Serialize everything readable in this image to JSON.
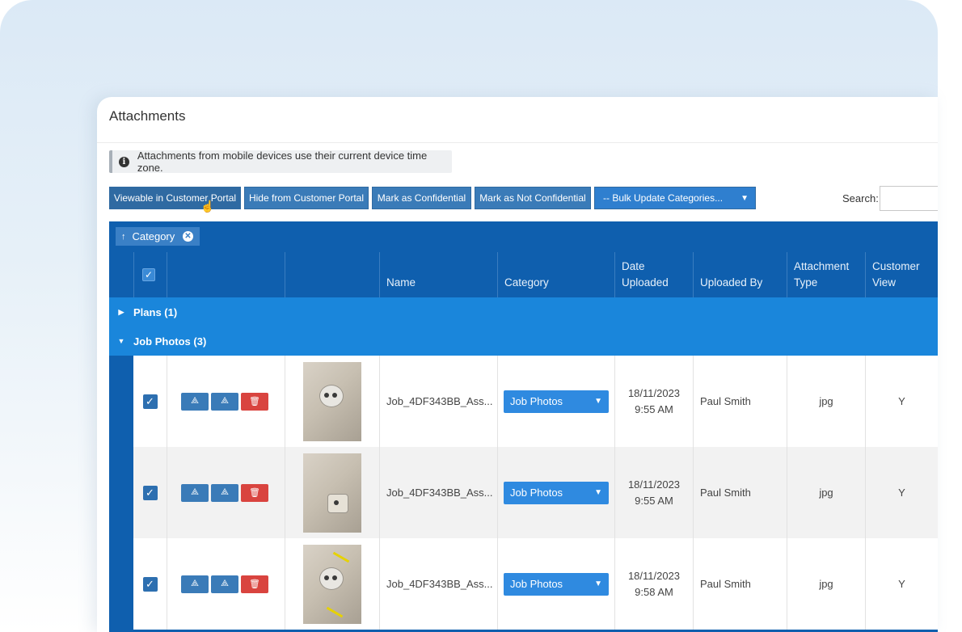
{
  "panel": {
    "title": "Attachments"
  },
  "notice": {
    "icon": "info-icon",
    "text": "Attachments from mobile devices use their current device time zone."
  },
  "toolbar": {
    "buttons": [
      "Viewable in Customer Portal",
      "Hide from Customer Portal",
      "Mark as Confidential",
      "Mark as Not Confidential"
    ],
    "bulk_dropdown": "-- Bulk Update Categories..."
  },
  "search": {
    "label": "Search:",
    "value": ""
  },
  "grouping": {
    "chip_label": "Category",
    "chip_arrow": "↑"
  },
  "columns": {
    "name": "Name",
    "category": "Category",
    "date_uploaded": "Date Uploaded",
    "uploaded_by": "Uploaded By",
    "attachment_type": "Attachment Type",
    "customer_view": "Customer View"
  },
  "groups": [
    {
      "label": "Plans (1)",
      "expanded": false
    },
    {
      "label": "Job Photos (3)",
      "expanded": true
    }
  ],
  "rows": [
    {
      "checked": true,
      "name": "Job_4DF343BB_Ass...",
      "category": "Job Photos",
      "date": "18/11/2023",
      "time": "9:55 AM",
      "uploaded_by": "Paul Smith",
      "type": "jpg",
      "customer_view": "Y"
    },
    {
      "checked": true,
      "name": "Job_4DF343BB_Ass...",
      "category": "Job Photos",
      "date": "18/11/2023",
      "time": "9:55 AM",
      "uploaded_by": "Paul Smith",
      "type": "jpg",
      "customer_view": "Y"
    },
    {
      "checked": true,
      "name": "Job_4DF343BB_Ass...",
      "category": "Job Photos",
      "date": "18/11/2023",
      "time": "9:58 AM",
      "uploaded_by": "Paul Smith",
      "type": "jpg",
      "customer_view": "Y"
    }
  ],
  "colors": {
    "header": "#0f5fae",
    "group_row": "#1a86db",
    "button": "#3a7bb8",
    "delete": "#d9443f"
  }
}
